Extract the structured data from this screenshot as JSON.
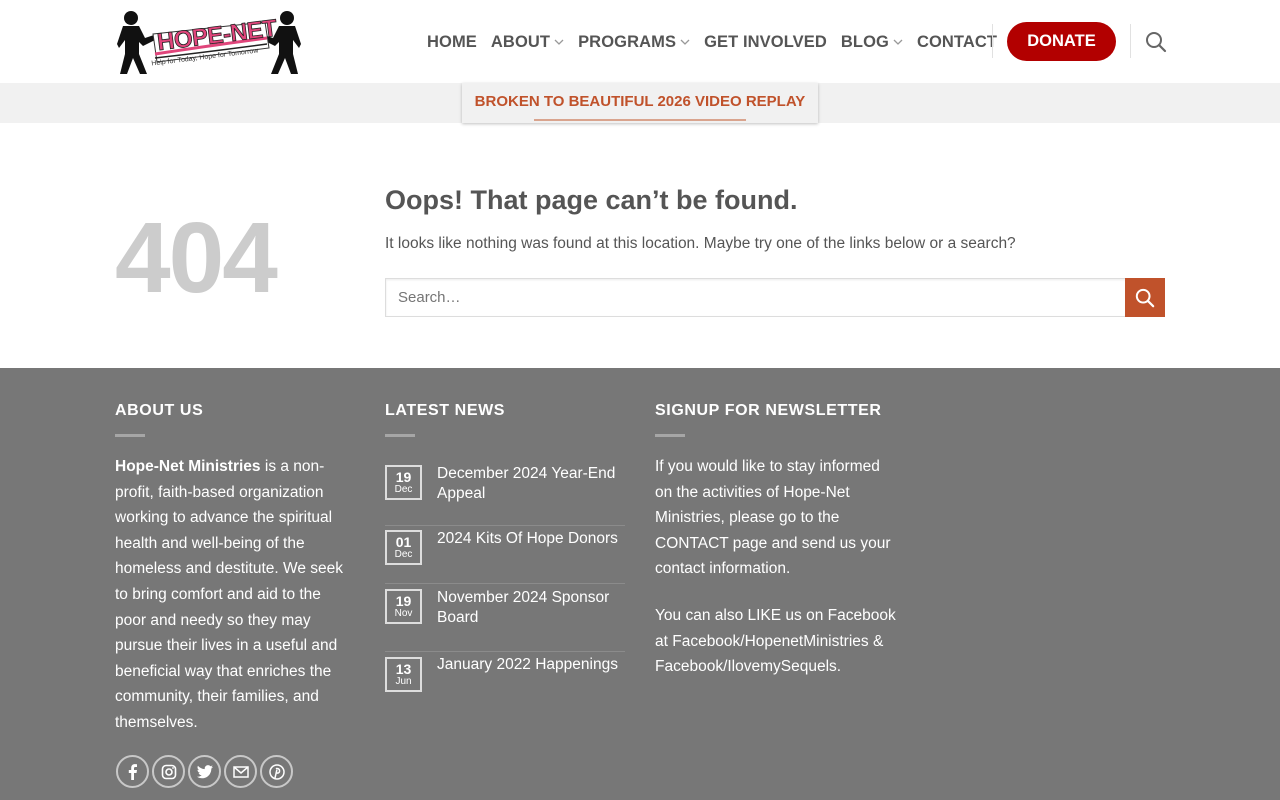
{
  "header": {
    "logo_text": "HOPE-NET",
    "logo_tagline": "Help for Today, Hope for Tomorrow",
    "nav": [
      {
        "label": "HOME",
        "has_dropdown": false
      },
      {
        "label": "ABOUT",
        "has_dropdown": true
      },
      {
        "label": "PROGRAMS",
        "has_dropdown": true
      },
      {
        "label": "GET INVOLVED",
        "has_dropdown": false
      },
      {
        "label": "BLOG",
        "has_dropdown": true
      },
      {
        "label": "CONTACT",
        "has_dropdown": false
      }
    ],
    "donate_label": "DONATE",
    "search_icon": "search-icon"
  },
  "announcement": {
    "label": "BROKEN TO BEAUTIFUL 2026 VIDEO REPLAY"
  },
  "error_page": {
    "code": "404",
    "title": "Oops! That page can’t be found.",
    "message": "It looks like nothing was found at this location. Maybe try one of the links below or a search?",
    "search_placeholder": "Search…"
  },
  "footer": {
    "about": {
      "title": "ABOUT US",
      "org_name": "Hope-Net Ministries",
      "body": " is a non-profit, faith-based organization working to advance the spiritual health and well-being of the homeless and destitute. We seek to bring comfort and aid to the poor and needy so they may pursue their lives in a useful and beneficial way that enriches the community, their families, and themselves."
    },
    "news": {
      "title": "LATEST NEWS",
      "items": [
        {
          "day": "19",
          "month": "Dec",
          "title": "December 2024 Year-End Appeal"
        },
        {
          "day": "01",
          "month": "Dec",
          "title": "2024 Kits Of Hope Donors"
        },
        {
          "day": "19",
          "month": "Nov",
          "title": "November 2024 Sponsor Board"
        },
        {
          "day": "13",
          "month": "Jun",
          "title": "January 2022 Happenings"
        }
      ]
    },
    "newsletter": {
      "title": "SIGNUP FOR NEWSLETTER",
      "p1": "If you would like to stay informed on the activities of Hope-Net Ministries, please go to the CONTACT page and send us your contact information.",
      "p2": "You can also LIKE us on Facebook at Facebook/HopenetMinistries & Facebook/IlovemySequels."
    },
    "socials": [
      "facebook-icon",
      "instagram-icon",
      "twitter-icon",
      "email-icon",
      "pinterest-icon"
    ]
  },
  "colors": {
    "donate": "#b20000",
    "accent": "#c0522b",
    "footer_bg": "#777777",
    "announce_bg": "#f1f1f1"
  }
}
